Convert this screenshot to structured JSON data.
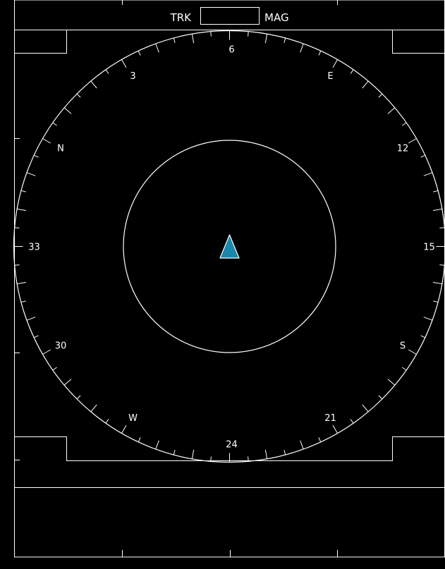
{
  "header": {
    "track_mode": "TRK",
    "heading_value": "",
    "reference": "MAG"
  },
  "compass": {
    "labels": [
      {
        "text": "6",
        "bearing": 60
      },
      {
        "text": "E",
        "bearing": 90
      },
      {
        "text": "12",
        "bearing": 120
      },
      {
        "text": "15",
        "bearing": 150
      },
      {
        "text": "S",
        "bearing": 180
      },
      {
        "text": "21",
        "bearing": 210
      },
      {
        "text": "24",
        "bearing": 240
      },
      {
        "text": "W",
        "bearing": 270
      },
      {
        "text": "30",
        "bearing": 300
      },
      {
        "text": "33",
        "bearing": 330
      },
      {
        "text": "N",
        "bearing": 0
      },
      {
        "text": "3",
        "bearing": 30
      }
    ],
    "heading_deg": 60,
    "tick_step_deg": 5
  },
  "ownship": {
    "symbol": "triangle-icon",
    "color": "#1a86aa"
  },
  "colors": {
    "background": "#000000",
    "lines": "#ffffff",
    "ownship": "#1a86aa"
  }
}
